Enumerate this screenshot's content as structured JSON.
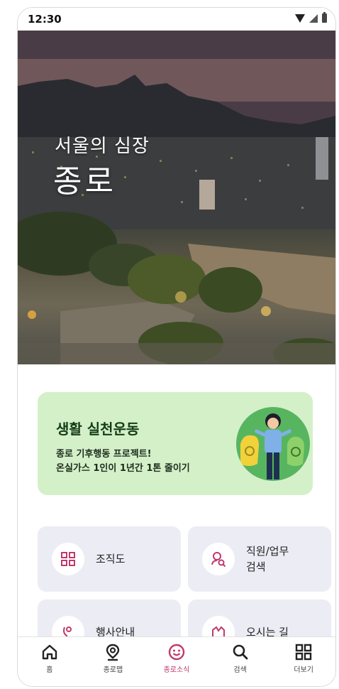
{
  "status_bar": {
    "time": "12:30"
  },
  "hero": {
    "subtitle": "서울의 심장",
    "title": "종로"
  },
  "banner": {
    "title": "생활 실천운동",
    "line1": "종로 기후행동 프로젝트!",
    "line2": "온실가스 1인이 1년간 1톤 줄이기"
  },
  "menu": [
    {
      "label": "조직도",
      "icon": "org-chart-icon"
    },
    {
      "label_line1": "직원/업무",
      "label_line2": "검색",
      "icon": "person-search-icon"
    },
    {
      "label": "행사안내",
      "icon": "event-icon"
    },
    {
      "label": "오시는 길",
      "icon": "directions-icon"
    }
  ],
  "nav": [
    {
      "label": "홈",
      "icon": "home-icon"
    },
    {
      "label": "종로맵",
      "icon": "map-pin-icon"
    },
    {
      "label": "종로소식",
      "icon": "smile-icon",
      "active": true
    },
    {
      "label": "검색",
      "icon": "search-icon"
    },
    {
      "label": "더보기",
      "icon": "grid-icon"
    }
  ],
  "colors": {
    "accent": "#c0396b",
    "banner_bg": "#d4f0c9",
    "card_bg": "#ececf4"
  }
}
